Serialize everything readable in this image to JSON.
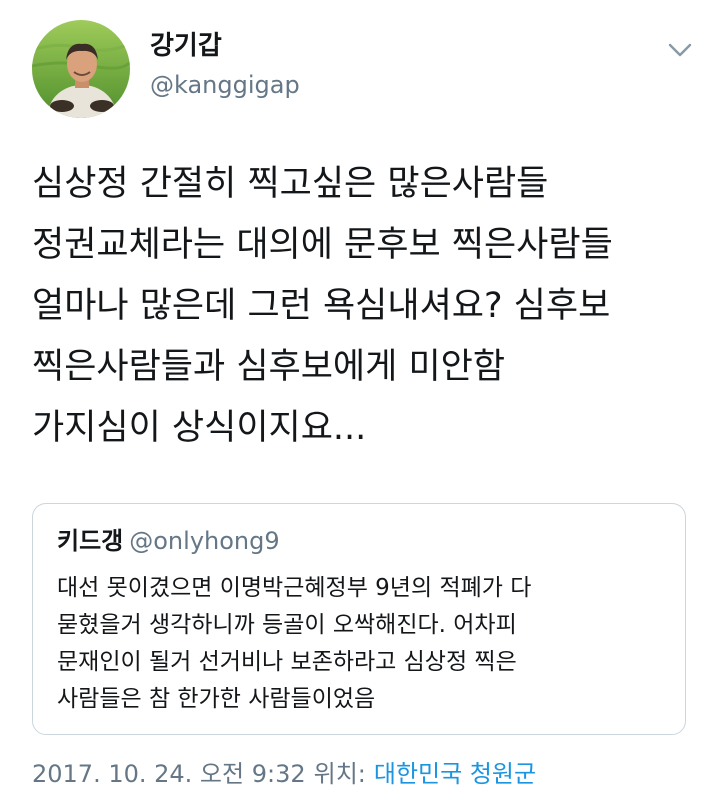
{
  "author": {
    "display_name": "강기갑",
    "handle": "@kanggigap",
    "avatar": "profile-photo-man-in-rice-field"
  },
  "menu": {
    "icon": "chevron-down-icon"
  },
  "tweet": {
    "lines": [
      "심상정 간절히 찍고싶은 많은사람들",
      "정권교체라는 대의에 문후보 찍은사람들",
      "얼마나 많은데 그런 욕심내셔요? 심후보",
      "찍은사람들과 심후보에게 미안함",
      "가지심이 상식이지요..."
    ]
  },
  "quoted_tweet": {
    "display_name": "키드갱",
    "handle": "@onlyhong9",
    "lines": [
      "대선 못이겼으면 이명박근혜정부 9년의 적폐가 다",
      "묻혔을거 생각하니까 등골이 오싹해진다. 어차피",
      "문재인이 될거 선거비나 보존하라고 심상정 찍은",
      "사람들은 참 한가한 사람들이었음"
    ]
  },
  "meta": {
    "timestamp": "2017. 10. 24. 오전 9:32",
    "location_label": "위치:",
    "location": "대한민국 청원군"
  },
  "colors": {
    "text": "#14171a",
    "secondary": "#657786",
    "link": "#1b95e0",
    "border": "#ccd6dd"
  }
}
